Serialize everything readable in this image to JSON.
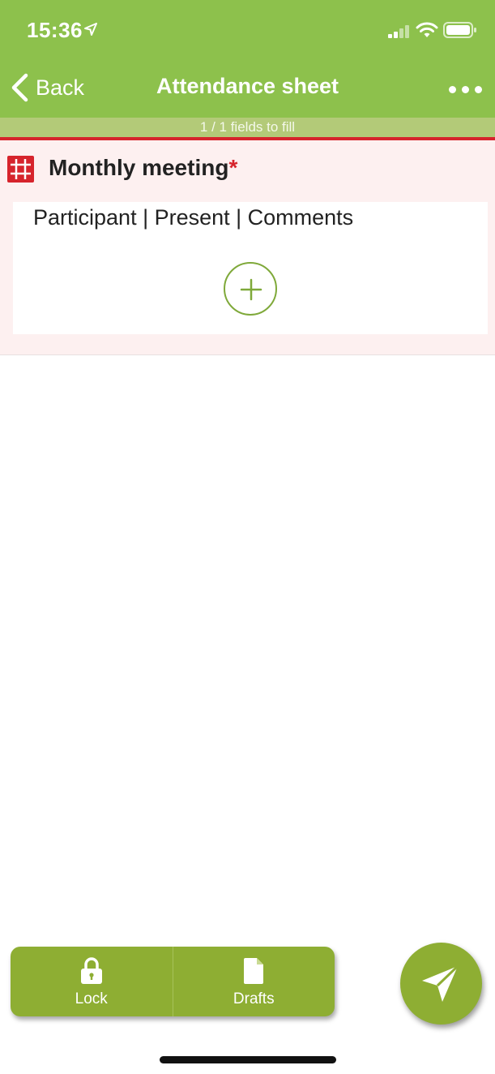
{
  "status_bar": {
    "time": "15:36",
    "icons": [
      "location-arrow-icon",
      "cellular-signal-icon",
      "wifi-icon",
      "battery-icon"
    ]
  },
  "nav": {
    "back_label": "Back",
    "title": "Attendance sheet",
    "more_icon": "more-dots-icon"
  },
  "progress": {
    "text": "1 / 1 fields to fill"
  },
  "field": {
    "icon": "grid-hashtag-icon",
    "title": "Monthly meeting",
    "required_mark": "*",
    "table_header": "Participant | Present | Comments",
    "add_icon": "plus-circle-icon"
  },
  "toolbar": {
    "lock_label": "Lock",
    "lock_icon": "lock-icon",
    "drafts_label": "Drafts",
    "drafts_icon": "document-icon"
  },
  "fab": {
    "icon": "paper-plane-send-icon"
  },
  "colors": {
    "header_green": "#8dc14c",
    "progress_strip": "#b3ca78",
    "required_red": "#d6242c",
    "field_bg": "#fdf0f0",
    "toolbar_green": "#8eae33",
    "add_outline": "#7fa93a"
  }
}
